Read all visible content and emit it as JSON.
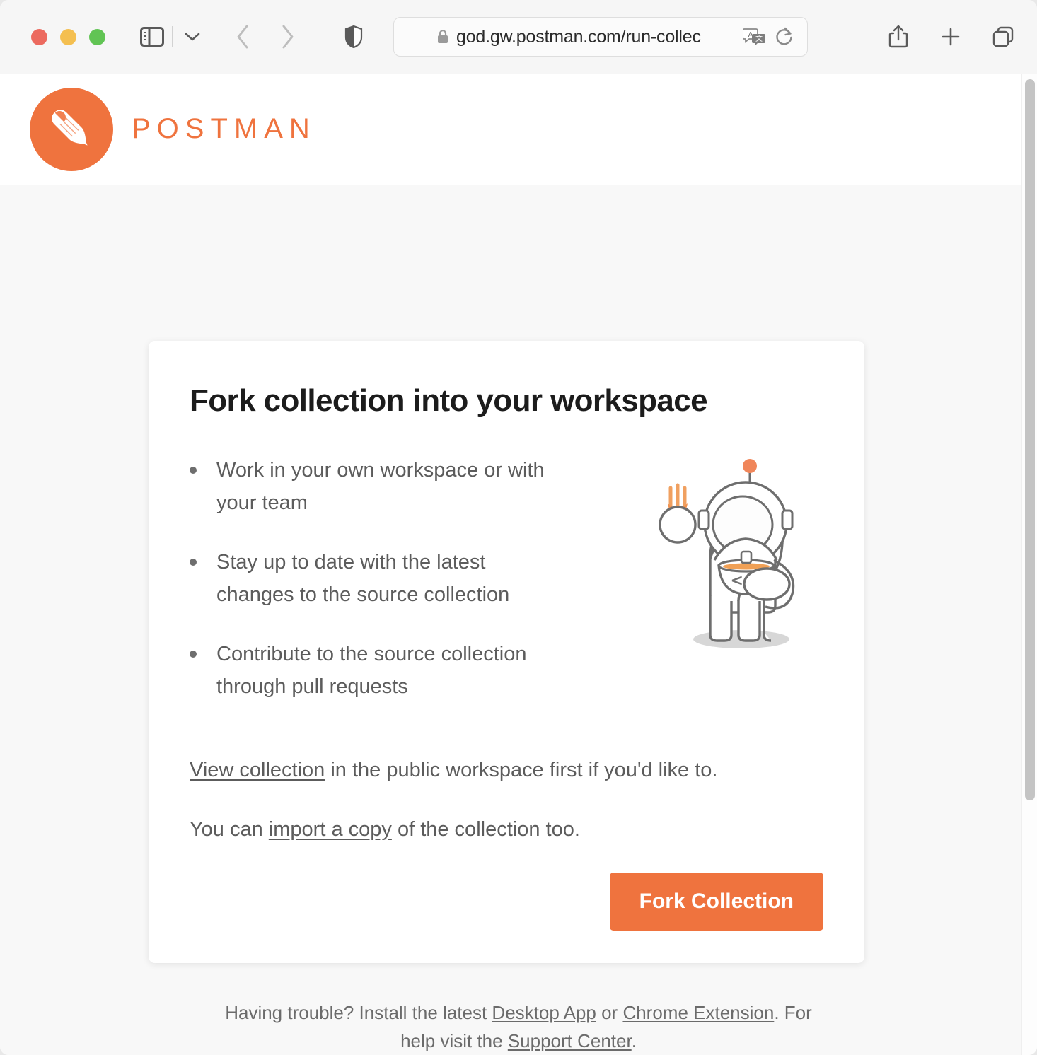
{
  "browser": {
    "window_controls": [
      {
        "name": "close",
        "color": "#ec6a5f"
      },
      {
        "name": "minimize",
        "color": "#f4bf50"
      },
      {
        "name": "maximize",
        "color": "#61c454"
      }
    ],
    "sidebar_toggle_label": "Show sidebar",
    "sidebar_dropdown_label": "Sidebar options",
    "back_label": "Back",
    "forward_label": "Forward",
    "shield_label": "Privacy Report",
    "url": "god.gw.postman.com/run-collec",
    "url_full_hint": "god.gw.postman.com/run-collection",
    "lock_label": "Secure connection",
    "translate_label": "Translate page",
    "reload_label": "Reload this page",
    "share_label": "Share",
    "new_tab_label": "New tab",
    "tab_overview_label": "Tab overview"
  },
  "page": {
    "brand": {
      "wordmark": "POSTMAN",
      "logo_icon": "postman-rocket-pen-icon",
      "accent_color": "#ef733e"
    },
    "card": {
      "title": "Fork collection into your workspace",
      "bullets": [
        "Work in your own workspace or with your team",
        "Stay up to date with the latest changes to the source collection",
        "Contribute to the source collection through pull requests"
      ],
      "illustration": "astronaut-with-fork-and-code-bowl-illustration",
      "view_line": {
        "link": "View collection",
        "rest": " in the public workspace first if you'd like to."
      },
      "import_line": {
        "before": "You can ",
        "link": "import a copy",
        "after": " of the collection too."
      },
      "primary_button": "Fork Collection"
    },
    "footer": {
      "part1": "Having trouble? Install the latest ",
      "link1": "Desktop App",
      "part2": " or ",
      "link2": "Chrome Extension",
      "part3": ". For help visit the ",
      "link3": "Support Center",
      "part4": "."
    }
  }
}
